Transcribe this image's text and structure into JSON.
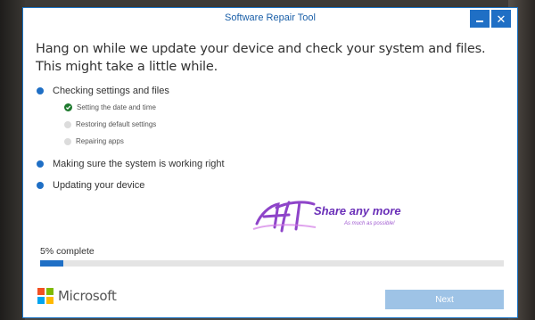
{
  "window": {
    "title": "Software Repair Tool"
  },
  "headline": "Hang on while we update your device and check your system and files. This might take a little while.",
  "steps": [
    {
      "label": "Checking settings and files",
      "substeps": [
        {
          "label": "Setting the date and time",
          "state": "done"
        },
        {
          "label": "Restoring default settings",
          "state": "pending"
        },
        {
          "label": "Repairing apps",
          "state": "pending"
        }
      ]
    },
    {
      "label": "Making sure the system is working right"
    },
    {
      "label": "Updating your device"
    }
  ],
  "watermark": {
    "brand": "Share any more",
    "tagline": "As much as possible!"
  },
  "progress": {
    "label": "5% complete",
    "percent": 5
  },
  "footer": {
    "brand": "Microsoft",
    "next_label": "Next"
  },
  "icons": {
    "minimize": "minimize-icon",
    "close": "close-icon",
    "check": "check-icon",
    "logo": "microsoft-logo-icon"
  },
  "colors": {
    "accent": "#1f6fc5",
    "done": "#1e7a2e",
    "pending": "#dcdcdc",
    "button_disabled": "#9ec3e6",
    "logo_red": "#f25022",
    "logo_green": "#7fba00",
    "logo_blue": "#00a4ef",
    "logo_yellow": "#ffb900"
  }
}
